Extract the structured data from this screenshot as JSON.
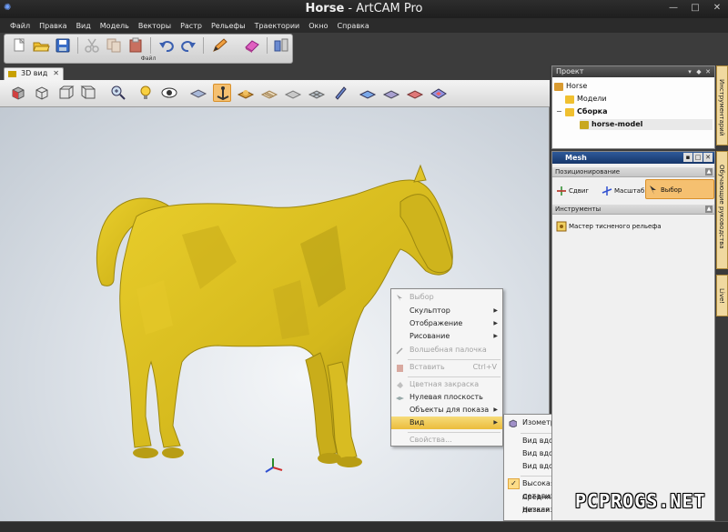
{
  "window": {
    "title_doc": "Horse",
    "title_sep": " - ",
    "title_app": "ArtCAM Pro",
    "min_glyph": "—",
    "max_glyph": "□",
    "close_glyph": "✕"
  },
  "menu": [
    "Файл",
    "Правка",
    "Вид",
    "Модель",
    "Векторы",
    "Растр",
    "Рельефы",
    "Траектории",
    "Окно",
    "Справка"
  ],
  "toolbar": {
    "group_label": "Файл"
  },
  "view": {
    "tab_label": "3D вид",
    "tab_close": "✕"
  },
  "context_menu": {
    "items": [
      {
        "label": "Выбор",
        "disabled": true
      },
      {
        "label": "Скульптор",
        "submenu": true
      },
      {
        "label": "Отображение",
        "submenu": true
      },
      {
        "label": "Рисование",
        "submenu": true
      },
      {
        "label": "Волшебная палочка",
        "disabled": true
      },
      {
        "label": "Вставить",
        "disabled": true,
        "shortcut": "Ctrl+V"
      },
      {
        "label": "Цветная закраска",
        "disabled": true
      },
      {
        "label": "Нулевая плоскость"
      },
      {
        "label": "Объекты для показа",
        "submenu": true
      },
      {
        "label": "Вид",
        "submenu": true,
        "highlight": true
      },
      {
        "label": "Свойства...",
        "disabled": true
      }
    ]
  },
  "view_submenu": {
    "items": [
      {
        "label": "Изометрия"
      },
      {
        "label": "Вид вдоль оси Z"
      },
      {
        "label": "Вид вдоль оси Y"
      },
      {
        "label": "Вид вдоль оси X"
      },
      {
        "label": "Высокая детализация",
        "checked": true
      },
      {
        "label": "Средняя детализация"
      },
      {
        "label": "Низкая детализация"
      }
    ],
    "check_glyph": "✓"
  },
  "project_panel": {
    "title": "Проект",
    "tree": [
      {
        "label": "Horse",
        "level": 0
      },
      {
        "label": "Модели",
        "level": 1
      },
      {
        "label": "Сборка",
        "level": 1,
        "expander": "−"
      },
      {
        "label": "horse-model",
        "level": 2,
        "selected": true
      }
    ]
  },
  "mesh_panel": {
    "title": "Mesh",
    "section_positioning": "Позиционирование",
    "btn_move": "Сдвиг",
    "btn_scale": "Масштаб",
    "btn_select": "Выбор объектов",
    "section_tools": "Инструменты",
    "btn_wizard": "Мастер тисненого рельефа"
  },
  "side_tabs": [
    "Инструментарий",
    "Обучающие руководства",
    "Live!"
  ],
  "watermark": "PCPROGS.NET",
  "colors": {
    "model": "#d8bb1e",
    "model_shadow": "#9c8710",
    "highlight": "#f5c070"
  }
}
